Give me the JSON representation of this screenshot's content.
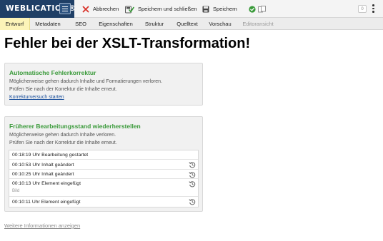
{
  "app": {
    "logo": "WEBLICATION®"
  },
  "toolbar": {
    "cancel_label": "Abbrechen",
    "save_close_label": "Speichern und schließen",
    "save_label": "Speichern",
    "counter": "0"
  },
  "tabs": [
    {
      "label": "Entwurf",
      "active": true
    },
    {
      "label": "Metadaten"
    },
    {
      "label": "SEO"
    },
    {
      "label": "Eigenschaften"
    },
    {
      "label": "Struktur"
    },
    {
      "label": "Quelltext"
    },
    {
      "label": "Vorschau"
    },
    {
      "label": "Editoransicht",
      "disabled": true
    }
  ],
  "main": {
    "headline": "Fehler bei der XSLT-Transformation!",
    "auto_fix": {
      "title": "Automatische Fehlerkorrektur",
      "line1": "Möglicherweise gehen dadurch Inhalte und Formatierungen verloren.",
      "line2": "Prüfen Sie nach der Korrektur die Inhalte erneut.",
      "link": "Korrekturversuch starten"
    },
    "restore": {
      "title": "Früherer Bearbeitungsstand wiederherstellen",
      "line1": "Möglicherweise gehen dadurch Inhalte verloren.",
      "line2": "Prüfen Sie nach der Korrektur die Inhalte erneut.",
      "history": [
        {
          "label": "00:18:19 Uhr Bearbeitung gestartet"
        },
        {
          "label": "00:10:53 Uhr Inhalt geändert",
          "icon": "restore-icon"
        },
        {
          "label": "00:10:25 Uhr Inhalt geändert",
          "icon": "restore-icon"
        },
        {
          "label": "00:10:13 Uhr Element eingefügt",
          "sub": "Bild",
          "icon": "restore-icon"
        },
        {
          "label": "00:10:11 Uhr Element eingefügt",
          "icon": "restore-icon"
        }
      ]
    },
    "more_link": "Weitere Informationen anzeigen"
  },
  "colors": {
    "brand": "#1f3f66",
    "active_tab": "#fcf4b8",
    "box_title": "#3a9a3a",
    "link": "#1a4f9c",
    "cancel_red": "#d9342b",
    "check_green": "#3a9a3a"
  }
}
